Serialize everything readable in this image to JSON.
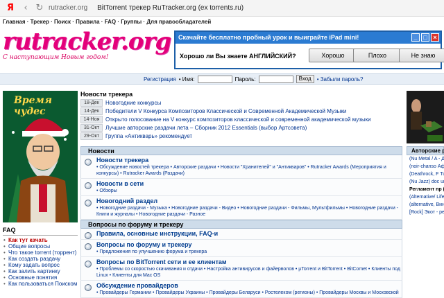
{
  "browser": {
    "brand_icon": "Я",
    "url_domain": "rutracker.org",
    "page_title": "BitTorrent трекер RuTracker.org (ex torrents.ru)"
  },
  "topnav": {
    "text": "Главная · Трекер · Поиск · Правила · FAQ · Группы · Для правообладателей"
  },
  "logo": {
    "text": "rutracker.org",
    "tagline": "С наступающим Новым годом!"
  },
  "ad": {
    "headline": "Скачайте бесплатно пробный урок и выиграйте iPad mini!",
    "question": "Хорошо ли Вы знаете АНГЛИЙСКИЙ?",
    "answers": [
      "Хорошо",
      "Плохо",
      "Не знаю"
    ]
  },
  "login": {
    "register": "Регистрация",
    "name_label": "• Имя:",
    "password_label": "Пароль:",
    "login_button": "Вход",
    "forgot": "• Забыли пароль?"
  },
  "promo": {
    "title": "Время чудес"
  },
  "faq": {
    "heading": "FAQ",
    "items": [
      "Как тут качать",
      "Общие вопросы",
      "Что такое torrent (торрент)",
      "Как создать раздачу",
      "Кому задать вопрос",
      "Как залить картинку",
      "Основные понятия",
      "Как пользоваться Поиском"
    ]
  },
  "tracker_news": {
    "heading": "Новости трекера",
    "items": [
      {
        "date": "18-Дек",
        "text": "Новогодние конкурсы"
      },
      {
        "date": "14-Дек",
        "text": "Победители V Конкурса Композиторов Классической и Современной Академической Музыки"
      },
      {
        "date": "14-Ноя",
        "text": "Открыто голосование на V конкурс композиторов классической и современной академической музыки"
      },
      {
        "date": "31-Окт",
        "text": "Лучшие авторские раздачи лета – Сборник 2012 Essentials (выбор Артсовета)"
      },
      {
        "date": "29-Окт",
        "text": "Группа «Антикварь» рекомендует"
      }
    ]
  },
  "forum": {
    "section_news": "Новости",
    "news_rows": [
      {
        "title": "Новости трекера",
        "sub": "• Обсуждение новостей трекера • Авторские раздачи • Новости \"Хранителей\" и \"Антикваров\" • Rutracker Awards (Мероприятия и конкурсы) • Rutracker Awards (Раздачи)"
      },
      {
        "title": "Новости в сети",
        "sub": "• Обзоры"
      },
      {
        "title": "Новогодний раздел",
        "sub": "• Новогодние раздачи - Музыка • Новогодние раздачи - Видео • Новогодние раздачи - Фильмы, Мультфильмы • Новогодние раздачи - Книги и журналы • Новогодние раздачи - Разное"
      }
    ],
    "section_questions": "Вопросы по форуму и трекеру",
    "question_rows": [
      {
        "title": "Правила, основные инструкции, FAQ-и",
        "sub": ""
      },
      {
        "title": "Вопросы по форуму и трекеру",
        "sub": "• Предложения по улучшению форума и трекера"
      },
      {
        "title": "Вопросы по BitTorrent сети и ее клиентам",
        "sub": "• Проблемы со скоростью скачивания и отдачи • Настройка антивирусов и файерволов • µTorrent и BitTorrent • BitComet • Клиенты под Linux • Клиенты для Mac OS"
      },
      {
        "title": "Обсуждение провайдеров",
        "sub": "• Провайдеры Германии • Провайдеры Украины • Провайдеры Беларуси • Ростелеком (регионы) • Провайдеры Москвы и Московской"
      }
    ]
  },
  "right_panel": {
    "heading": "Авторские ре",
    "items": [
      "(Nu Metal / A - Другие - 201",
      "(noir-chanso Аффинаж » Д",
      "(Deathrock, F Tussor - Дети",
      "(Nu Jazz) doc unreleased a 2013",
      "Регламент пр (Или как пол раздачу)",
      "(Alternative/ Life - EP \"Я те",
      "(alternative, Виноград-на",
      "[Rock] Экот - релиз) 2013"
    ]
  }
}
